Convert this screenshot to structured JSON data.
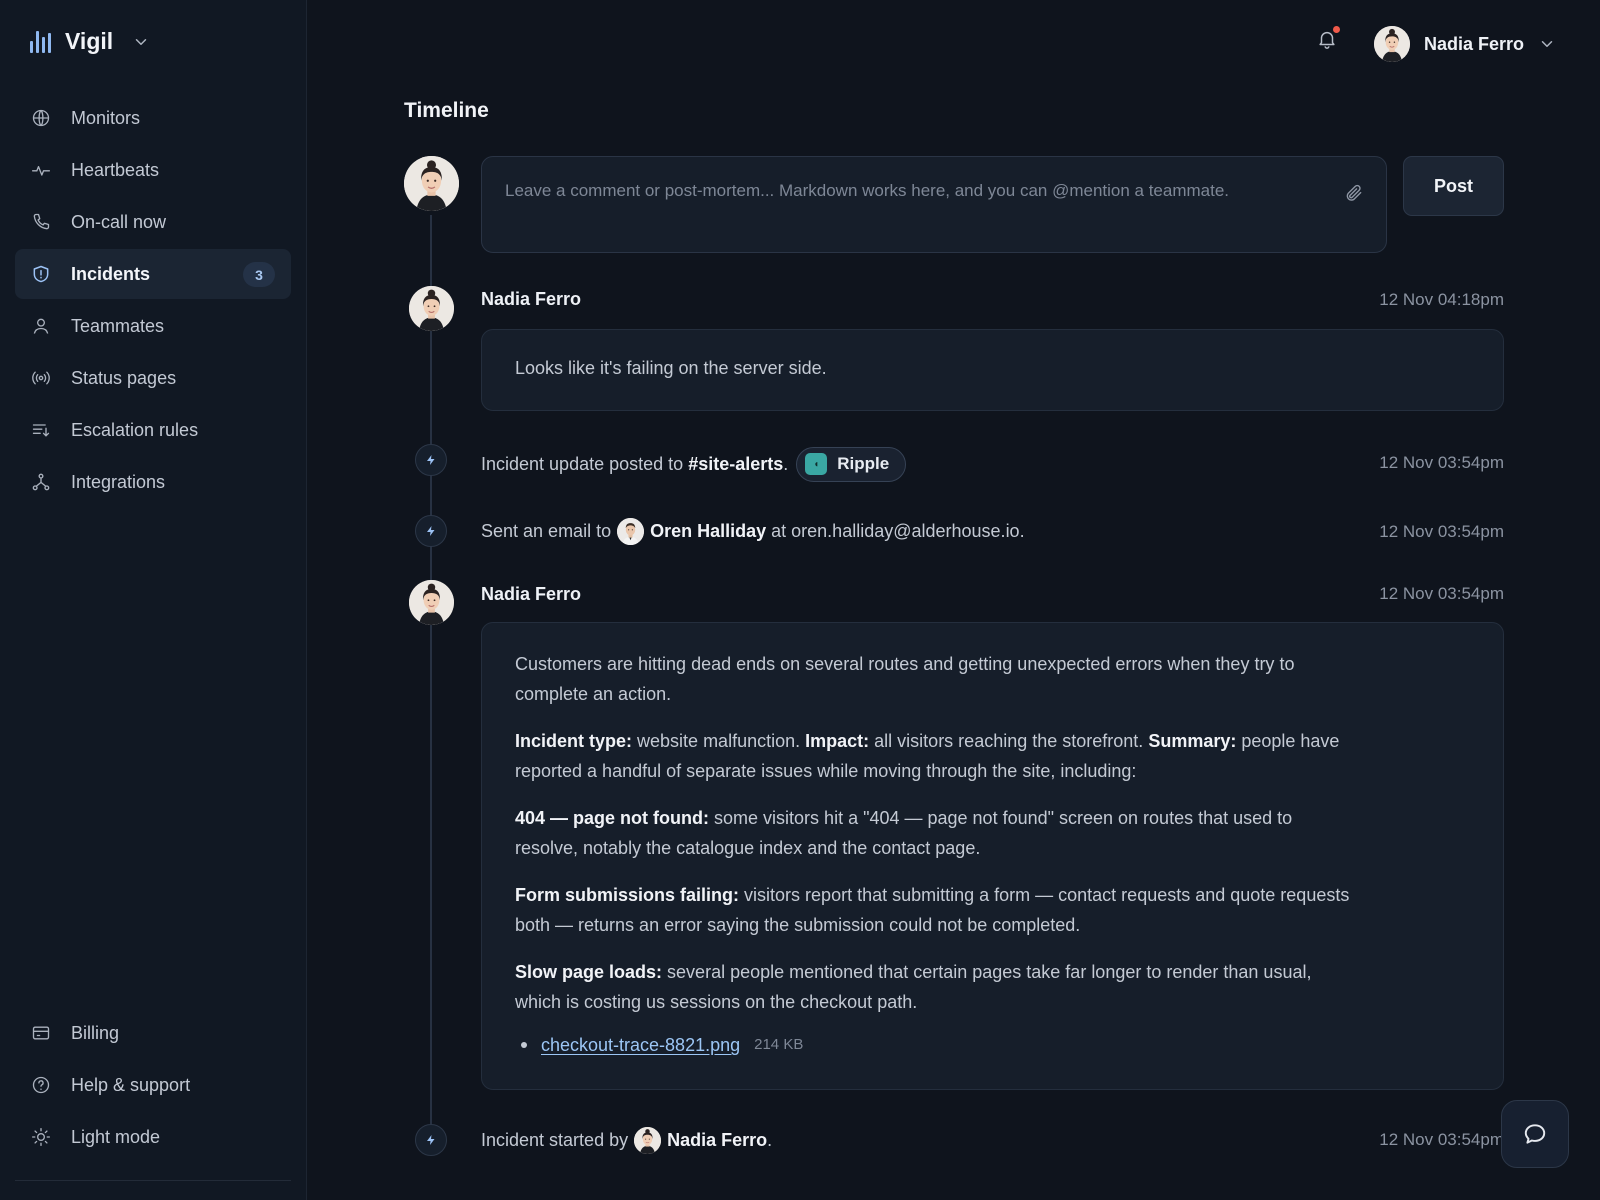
{
  "app": {
    "name": "Vigil",
    "icons": {
      "logo": "bar-chart-logo-icon",
      "switcher": "chevron-down-icon"
    }
  },
  "sidebar": {
    "items": [
      {
        "label": "Monitors",
        "icon": "globe-icon"
      },
      {
        "label": "Heartbeats",
        "icon": "pulse-icon"
      },
      {
        "label": "On-call now",
        "icon": "phone-icon"
      },
      {
        "label": "Incidents",
        "icon": "shield-alert-icon",
        "badge": "3",
        "active": true
      },
      {
        "label": "Teammates",
        "icon": "user-icon"
      },
      {
        "label": "Status pages",
        "icon": "broadcast-icon"
      },
      {
        "label": "Escalation rules",
        "icon": "list-sort-icon"
      },
      {
        "label": "Integrations",
        "icon": "nodes-icon"
      }
    ],
    "bottom_items": [
      {
        "label": "Billing",
        "icon": "credit-card-icon"
      },
      {
        "label": "Help & support",
        "icon": "help-circle-icon"
      },
      {
        "label": "Light mode",
        "icon": "sun-icon"
      }
    ]
  },
  "header": {
    "user_name": "Nadia Ferro",
    "notification_dot_color": "#f05a4a"
  },
  "timeline": {
    "title": "Timeline",
    "composer": {
      "placeholder": "Leave a comment or post-mortem... Markdown works here, and you can @mention a teammate.",
      "post_label": "Post"
    },
    "comment_1": {
      "author": "Nadia Ferro",
      "time": "12 Nov 04:18pm",
      "text": "Looks like it's failing on the server side."
    },
    "event_1": {
      "prefix": "Incident update posted to",
      "channel": "#site-alerts",
      "suffix": ".",
      "pill": "Ripple",
      "time": "12 Nov 03:54pm"
    },
    "event_2": {
      "prefix": "Sent an email to",
      "person": "Oren Halliday",
      "suffix": "at oren.halliday@alderhouse.io.",
      "time": "12 Nov 03:54pm"
    },
    "comment_2": {
      "author": "Nadia Ferro",
      "time": "12 Nov 03:54pm",
      "intro": "Customers are hitting dead ends on several routes and getting unexpected errors when they try to complete an action.",
      "type_label": "Incident type:",
      "type_value": "website malfunction.",
      "impact_label": "Impact:",
      "impact_value": "all visitors reaching the storefront.",
      "summary_label": "Summary:",
      "summary_value": "people have reported a handful of separate issues while moving through the site, including:",
      "issue_404_label": "404 — page not found:",
      "issue_404_text": "some visitors hit a \"404 — page not found\" screen on routes that used to resolve, notably the catalogue index and the contact page.",
      "issue_form_label": "Form submissions failing:",
      "issue_form_text": "visitors report that submitting a form — contact requests and quote requests both — returns an error saying the submission could not be completed.",
      "issue_slow_label": "Slow page loads:",
      "issue_slow_text": "several people mentioned that certain pages take far longer to render than usual, which is costing us sessions on the checkout path.",
      "attachment_name": "checkout-trace-8821.png",
      "attachment_size": "214 KB"
    },
    "event_3": {
      "prefix": "Incident started by",
      "person": "Nadia Ferro",
      "suffix": ".",
      "time": "12 Nov 03:54pm"
    }
  },
  "colors": {
    "background": "#0f141d",
    "sidebar": "#111823",
    "accent": "#9cc2f5",
    "card": "#161e2a"
  }
}
